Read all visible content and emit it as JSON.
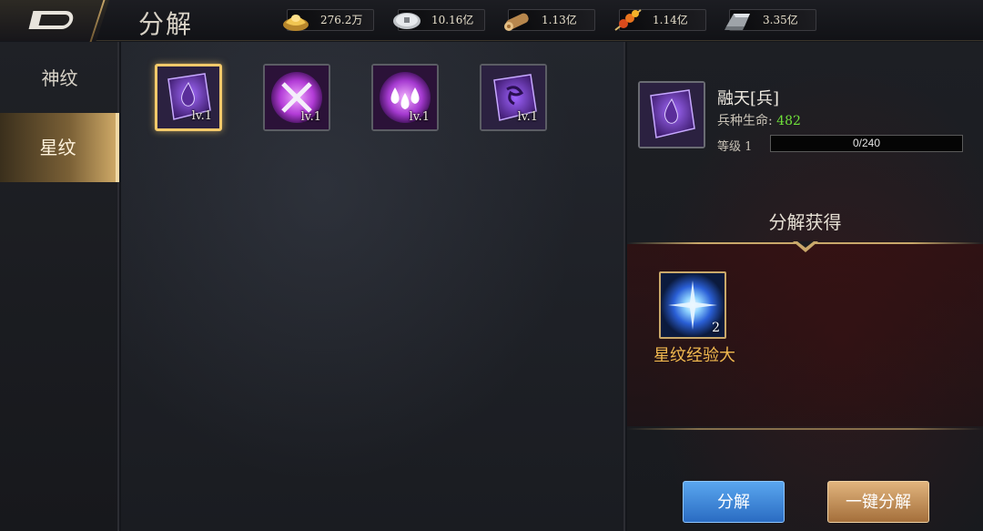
{
  "header": {
    "title": "分解",
    "resources": [
      {
        "icon": "gold-ingot-icon",
        "value": "276.2万"
      },
      {
        "icon": "silver-coin-icon",
        "value": "10.16亿"
      },
      {
        "icon": "wood-log-icon",
        "value": "1.13亿"
      },
      {
        "icon": "meat-skewer-icon",
        "value": "1.14亿"
      },
      {
        "icon": "iron-ingot-icon",
        "value": "3.35亿"
      }
    ]
  },
  "sidebar": {
    "items": [
      {
        "label": "神纹",
        "active": false
      },
      {
        "label": "星纹",
        "active": true
      }
    ]
  },
  "inventory": {
    "slots": [
      {
        "icon": "teardrop-rune-icon",
        "level": "lv.1",
        "selected": true
      },
      {
        "icon": "crossed-swords-rune-icon",
        "level": "lv.1",
        "selected": false
      },
      {
        "icon": "water-drops-rune-icon",
        "level": "lv.1",
        "selected": false
      },
      {
        "icon": "tribal-rune-icon",
        "level": "lv.1",
        "selected": false
      }
    ]
  },
  "detail": {
    "item_name": "融天[兵]",
    "stat_label": "兵种生命:",
    "stat_value": "482",
    "level_label": "等级 1",
    "exp_text": "0/240",
    "exp_progress": 0.0,
    "reward_header": "分解获得",
    "reward": {
      "icon": "star-burst-icon",
      "count": "2",
      "name": "星纹经验大"
    }
  },
  "actions": {
    "decompose_label": "分解",
    "decompose_all_label": "一键分解"
  },
  "colors": {
    "accent_gold": "#c9a86a",
    "stat_green": "#6fe03a",
    "reward_orange": "#f0b84f",
    "button_blue": "#2a6cc2"
  }
}
